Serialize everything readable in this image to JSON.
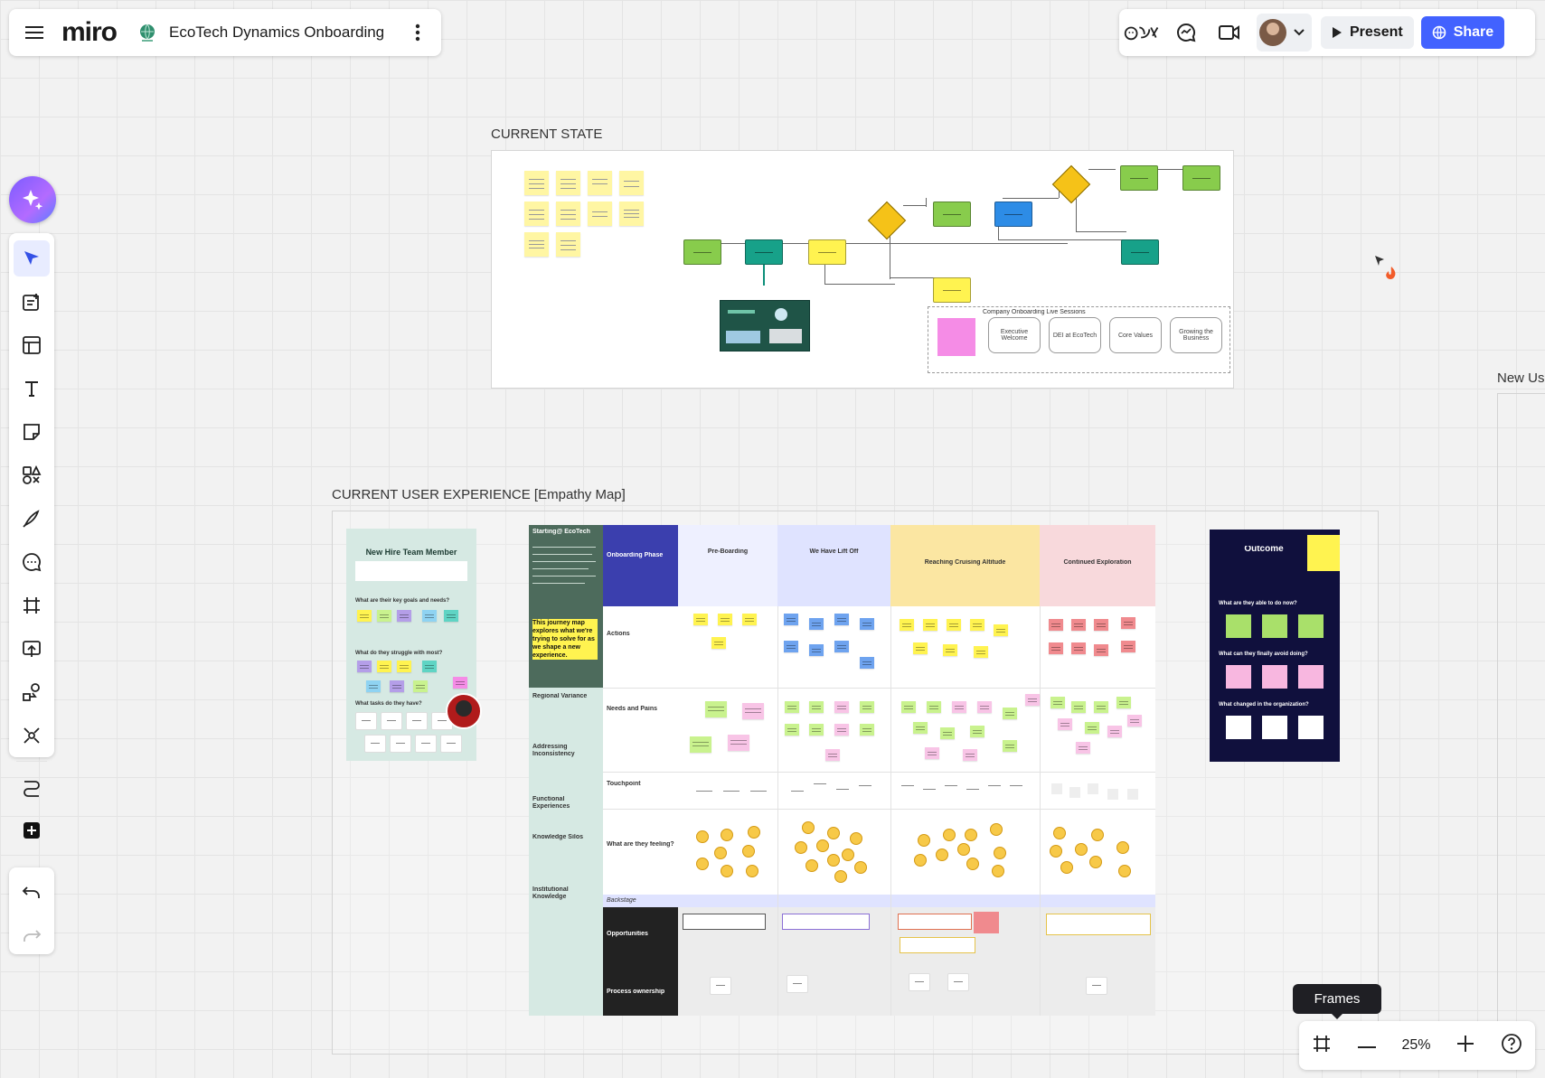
{
  "app": {
    "logo": "miro",
    "board_title": "EcoTech Dynamics Onboarding"
  },
  "header": {
    "present_label": "Present",
    "share_label": "Share"
  },
  "zoom": {
    "level": "25%",
    "frames_tooltip": "Frames"
  },
  "frames": {
    "current_state": "CURRENT STATE",
    "empathy_map": "CURRENT USER EXPERIENCE [Empathy Map]",
    "new_user": "New Us"
  },
  "current_state": {
    "sessions_title": "Company Onboarding Live Sessions",
    "sessions": [
      "Executive Welcome",
      "DEI at EcoTech",
      "Core Values",
      "Growing the Business"
    ]
  },
  "persona": {
    "title": "New Hire Team Member",
    "q1": "What are their key goals and needs?",
    "q2": "What do they struggle with most?",
    "q3": "What tasks do they have?"
  },
  "outcome": {
    "title": "Outcome",
    "q1": "What are they able to do now?",
    "q2": "What can they finally avoid doing?",
    "q3": "What changed in the organization?"
  },
  "journey": {
    "intro_title": "Starting@ EcoTech",
    "intro_highlight": "This journey map explores what we're trying to solve for as we shape a new experience.",
    "onboarding_phase": "Onboarding Phase",
    "phases": [
      "Pre-Boarding",
      "We Have Lift Off",
      "Reaching Cruising Altitude",
      "Continued Exploration"
    ],
    "rows": [
      "Actions",
      "Needs and Pains",
      "Touchpoint",
      "What are they feeling?",
      "Backstage",
      "Opportunities",
      "Process ownership"
    ],
    "side_notes": [
      "Regional Variance",
      "Addressing Inconsistency",
      "Functional Experiences",
      "Knowledge Silos",
      "Institutional Knowledge"
    ]
  },
  "colors": {
    "accent": "#4262ff",
    "canvas": "#f2f2f2",
    "outcome_bg": "#10103d",
    "persona_bg": "#d6e9e3",
    "journey_side": "#4d6b5c",
    "phase_onboarding": "#3b3fae",
    "phase_pre": "#eef0ff",
    "phase_lift": "#dfe3ff",
    "phase_cruise": "#fbe6a2",
    "phase_explore": "#f8d9dc"
  }
}
